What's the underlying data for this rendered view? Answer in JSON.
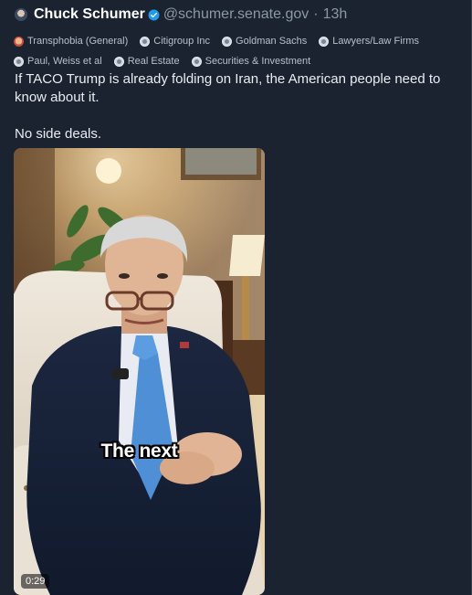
{
  "author": {
    "display_name": "Chuck Schumer",
    "handle": "@schumer.senate.gov",
    "separator": "·",
    "time": "13h",
    "verified": true,
    "avatar_icon": "senator-portrait-avatar"
  },
  "tags": {
    "row1": [
      {
        "label": "Transphobia (General)",
        "icon": "face-emoji-icon"
      },
      {
        "label": "Citigroup Inc",
        "icon": "seal-icon"
      },
      {
        "label": "Goldman Sachs",
        "icon": "seal-icon"
      },
      {
        "label": "Lawyers/Law Firms",
        "icon": "seal-icon"
      }
    ],
    "row2": [
      {
        "label": "Paul, Weiss et al",
        "icon": "seal-icon"
      },
      {
        "label": "Real Estate",
        "icon": "seal-icon"
      },
      {
        "label": "Securities & Investment",
        "icon": "seal-icon"
      }
    ]
  },
  "post": {
    "paragraph1": "If TACO Trump is already folding on Iran, the American people need to know about it.",
    "paragraph2": "No side deals."
  },
  "video": {
    "caption": "The next",
    "duration": "0:29"
  },
  "colors": {
    "background": "#1b2330",
    "verified_blue": "#1d9bf0",
    "muted_text": "#8b98a5"
  }
}
